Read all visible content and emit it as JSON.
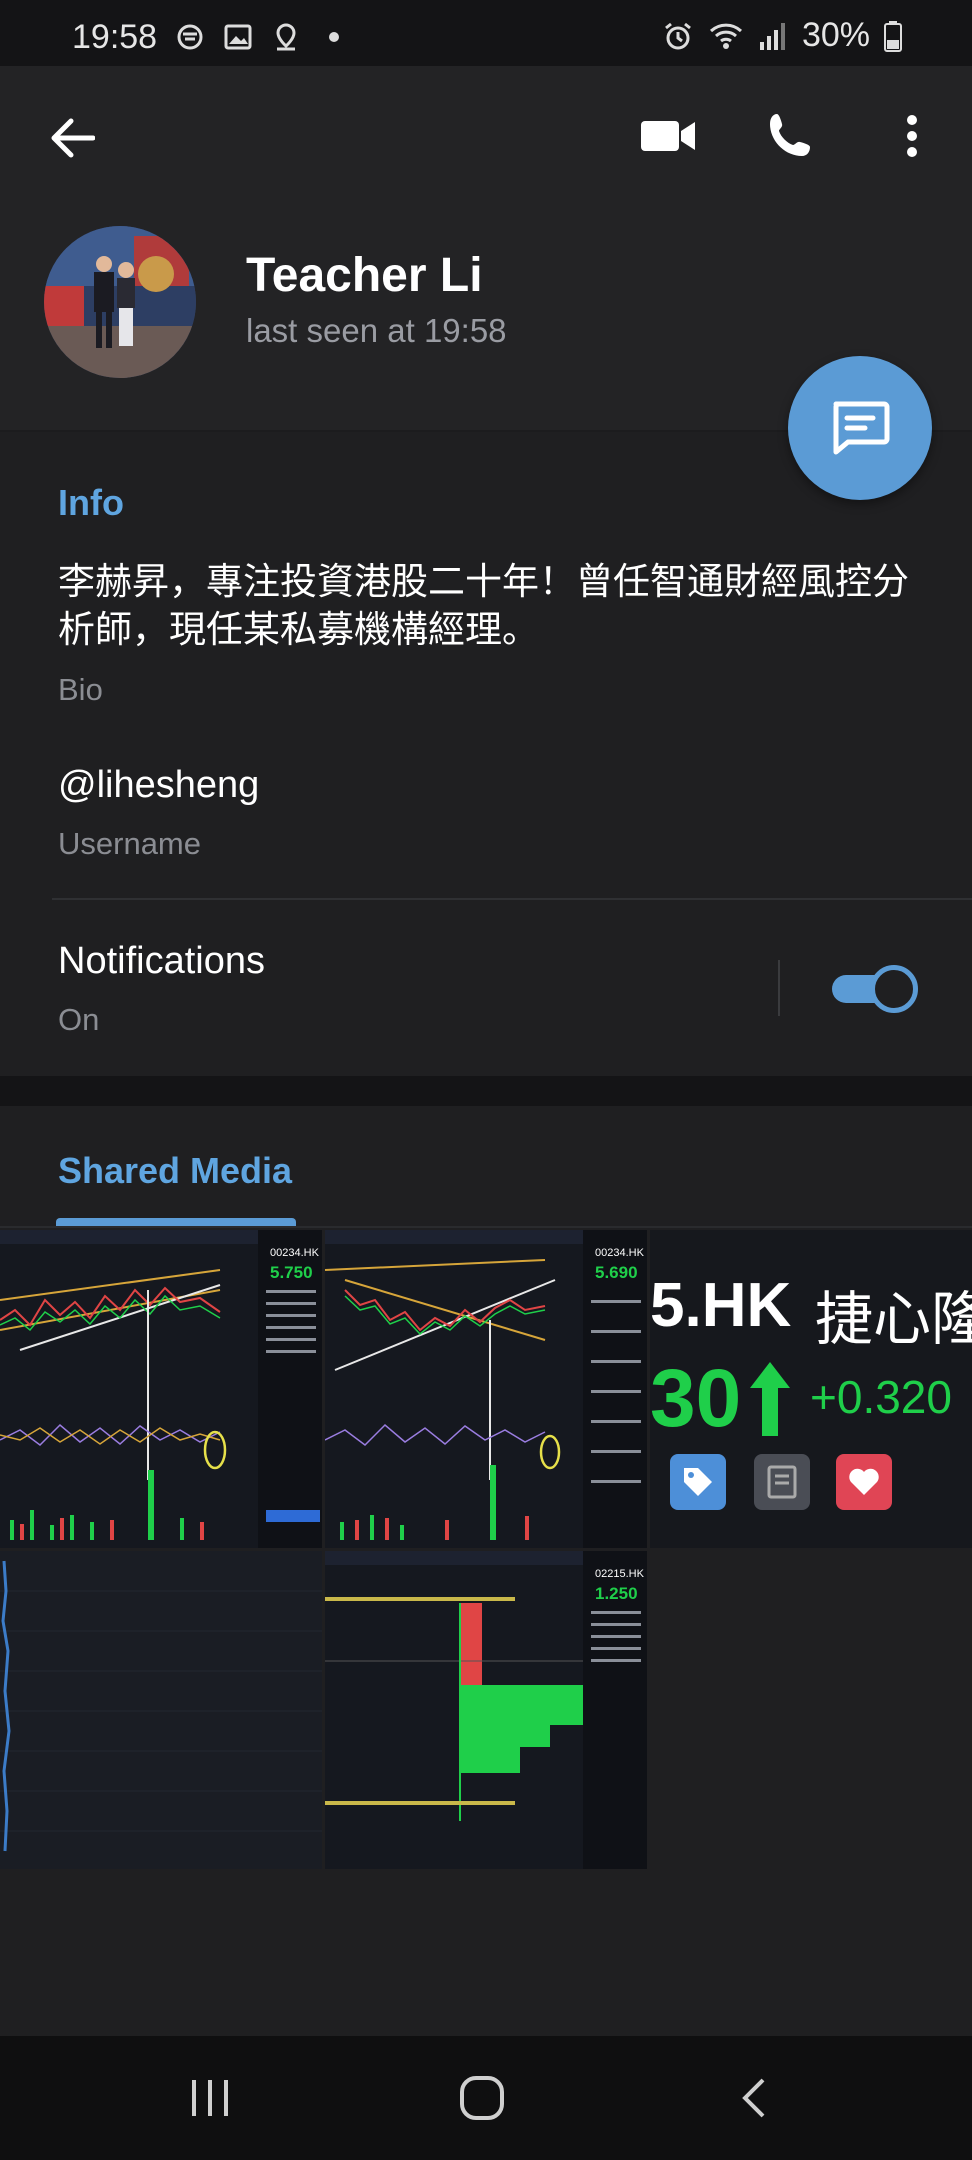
{
  "status_bar": {
    "time": "19:58",
    "battery": "30%",
    "icons_left": [
      "app-icon",
      "gallery-icon",
      "location-icon",
      "dot-icon"
    ],
    "icons_right": [
      "alarm-icon",
      "wifi-icon",
      "signal-icon",
      "battery-icon"
    ]
  },
  "header": {
    "name": "Teacher Li",
    "status": "last seen at 19:58"
  },
  "info": {
    "title": "Info",
    "bio": "李赫昇，專注投資港股二十年！曾任智通財經風控分析師，現任某私募機構經理。",
    "bio_label": "Bio",
    "username": "@lihesheng",
    "username_label": "Username",
    "notifications": "Notifications",
    "notifications_state": "On",
    "notifications_enabled": true
  },
  "shared_media": {
    "title": "Shared Media",
    "thumb3": {
      "ticker": "5.HK",
      "name": "捷心隆",
      "price": "30",
      "change": "+0.320"
    },
    "thumb1_price": "5.750",
    "thumb2_price": "5.690",
    "thumb5_price": "1.250",
    "thumb1_code": "00234.HK",
    "thumb2_code": "00234.HK",
    "thumb5_code": "02215.HK"
  },
  "colors": {
    "accent": "#5b9bd5",
    "background": "#1f1f21",
    "header_bg": "#232325",
    "up_green": "#1fcf4a",
    "down_red": "#e04545"
  }
}
